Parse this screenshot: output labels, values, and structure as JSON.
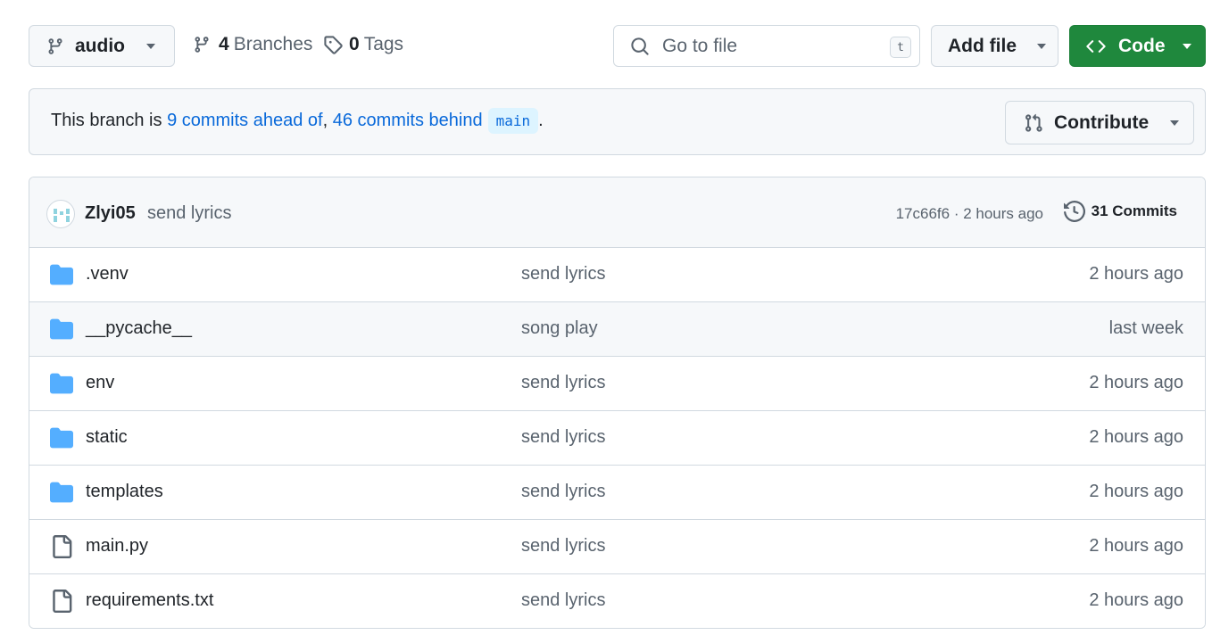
{
  "branch_selector": {
    "label": "audio"
  },
  "branches": {
    "count": "4",
    "label": "Branches"
  },
  "tags": {
    "count": "0",
    "label": "Tags"
  },
  "search": {
    "placeholder": "Go to file",
    "shortcut": "t"
  },
  "add_file": {
    "label": "Add file"
  },
  "code": {
    "label": "Code",
    "color": "#1f883d"
  },
  "banner": {
    "prefix": "This branch is ",
    "ahead": "9 commits ahead of",
    "separator": ", ",
    "behind": "46 commits behind",
    "base_branch": "main",
    "suffix": ".",
    "contribute_label": "Contribute"
  },
  "latest_commit": {
    "author": "Zlyi05",
    "message": "send lyrics",
    "hash": "17c66f6",
    "dot": " · ",
    "time": "2 hours ago",
    "commits_label": "31 Commits"
  },
  "files": [
    {
      "name": ".venv",
      "type": "folder",
      "message": "send lyrics",
      "age": "2 hours ago"
    },
    {
      "name": "__pycache__",
      "type": "folder",
      "message": "song play",
      "age": "last week"
    },
    {
      "name": "env",
      "type": "folder",
      "message": "send lyrics",
      "age": "2 hours ago"
    },
    {
      "name": "static",
      "type": "folder",
      "message": "send lyrics",
      "age": "2 hours ago"
    },
    {
      "name": "templates",
      "type": "folder",
      "message": "send lyrics",
      "age": "2 hours ago"
    },
    {
      "name": "main.py",
      "type": "file",
      "message": "send lyrics",
      "age": "2 hours ago"
    },
    {
      "name": "requirements.txt",
      "type": "file",
      "message": "send lyrics",
      "age": "2 hours ago"
    }
  ],
  "colors": {
    "folder": "#54aeff",
    "link": "#0969da",
    "border": "#d1d9e0",
    "muted": "#59636e"
  }
}
